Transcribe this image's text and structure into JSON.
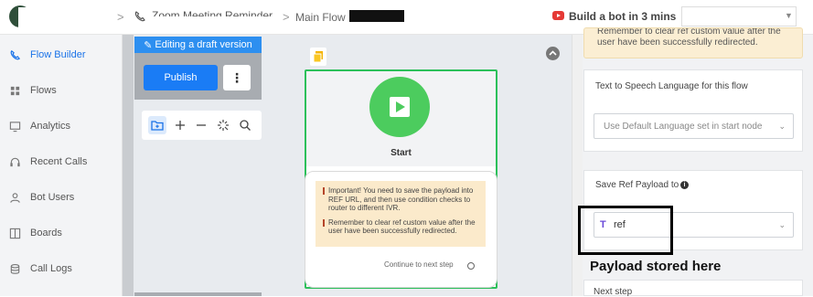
{
  "topbar": {
    "flow_name": "Zoom Meeting Reminder",
    "main_flow": "Main Flow",
    "build_bot_label": "Build a bot in 3 mins",
    "separator": ">"
  },
  "sidebar": {
    "items": [
      {
        "label": "Flow Builder",
        "icon": "flow-builder-icon"
      },
      {
        "label": "Flows",
        "icon": "grid-icon"
      },
      {
        "label": "Analytics",
        "icon": "analytics-icon"
      },
      {
        "label": "Recent Calls",
        "icon": "headset-icon"
      },
      {
        "label": "Bot Users",
        "icon": "user-icon"
      },
      {
        "label": "Boards",
        "icon": "board-icon"
      },
      {
        "label": "Call Logs",
        "icon": "database-icon"
      }
    ],
    "active_index": 0
  },
  "canvas": {
    "draft_label": "Editing a draft version",
    "publish_label": "Publish",
    "more_label": "⋮",
    "tools": [
      "folder-icon",
      "plus-icon",
      "minus-icon",
      "magic-icon",
      "search-icon"
    ],
    "start_node": {
      "title": "Start",
      "note_1": "Important! You need to save the payload into REF URL, and then use condition checks to router to different IVR.",
      "note_2": "Remember to clear ref custom value after the user have been successfully redirected.",
      "continue_label": "Continue to next step"
    }
  },
  "right_panel": {
    "reminder_text": "Remember to clear ref custom value after the user have been successfully redirected.",
    "tts_label": "Text to Speech Language for this flow",
    "tts_select_value": "Use Default Language set in start node",
    "ref_label": "Save Ref Payload to",
    "ref_value": "ref",
    "annotation": "Payload stored here",
    "next_step_label": "Next step"
  },
  "colors": {
    "accent": "#1a7cf5",
    "start_green": "#4ccc5e",
    "node_border": "#2cc05a",
    "note_bg": "#fbeacb"
  }
}
